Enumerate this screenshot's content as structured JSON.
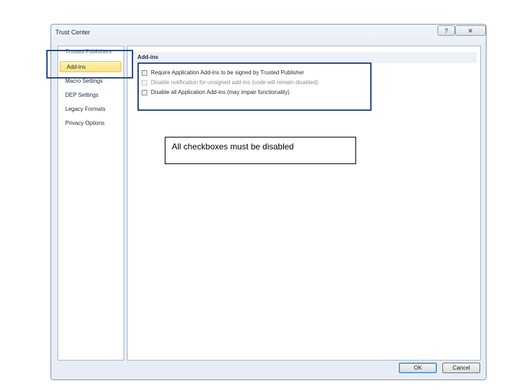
{
  "window": {
    "title": "Trust Center",
    "help_label": "?",
    "close_label": "✕"
  },
  "nav": {
    "items": [
      {
        "label": "Trusted Publishers"
      },
      {
        "label": "Add-ins",
        "selected": true
      },
      {
        "label": "Macro Settings"
      },
      {
        "label": "DEP Settings"
      },
      {
        "label": "Legacy Formats"
      },
      {
        "label": "Privacy Options"
      }
    ]
  },
  "content": {
    "section_title": "Add-ins",
    "options": [
      {
        "label": "Require Application Add-ins to be signed by Trusted Publisher",
        "checked": false,
        "enabled": true
      },
      {
        "label": "Disable notification for unsigned add-ins (code will remain disabled)",
        "checked": false,
        "enabled": false
      },
      {
        "label": "Disable all Application Add-ins (may impair functionality)",
        "checked": false,
        "enabled": true
      }
    ]
  },
  "buttons": {
    "ok_label": "OK",
    "cancel_label": "Cancel"
  },
  "annotation": {
    "note_text": "All checkboxes must be disabled",
    "highlight_color": "#2f4a80"
  },
  "colors": {
    "selected_nav_bg": "#fde27a",
    "dialog_bg": "#e6edf6"
  }
}
